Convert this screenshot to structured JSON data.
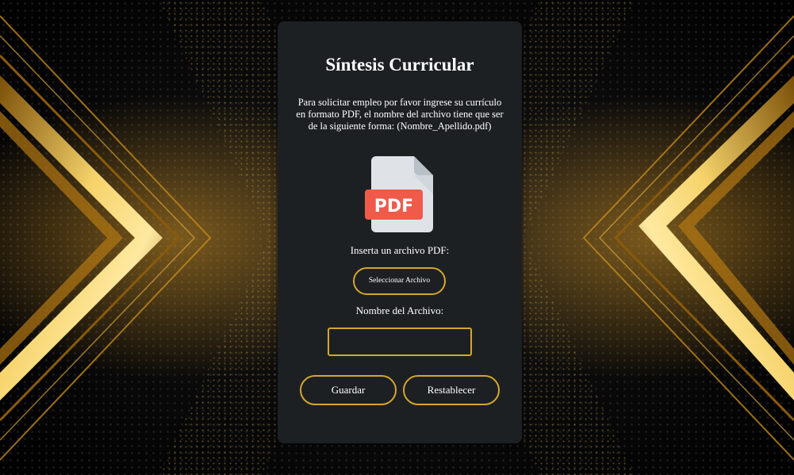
{
  "form": {
    "title": "Síntesis Curricular",
    "description": "Para solicitar empleo por favor ingrese su currículo en formato PDF, el nombre del archivo tiene que ser de la siguiente forma: (Nombre_Apellido.pdf)",
    "pdf_icon_label": "PDF",
    "insert_label": "Inserta un archivo PDF:",
    "select_button": "Seleccionar Archivo",
    "filename_label": "Nombre del Archivo:",
    "filename_value": "",
    "save_button": "Guardar",
    "reset_button": "Restablecer"
  },
  "colors": {
    "accent_gold": "#d4a72c",
    "card_bg": "#1d2023",
    "pdf_badge": "#ef5a4a",
    "page_bg": "#050505"
  },
  "icons": [
    "pdf-file-icon"
  ]
}
